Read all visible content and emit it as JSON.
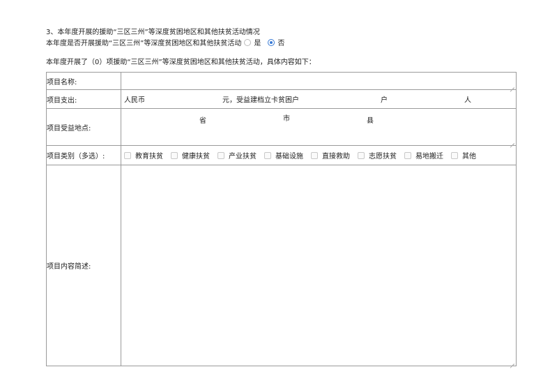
{
  "section": {
    "heading": "3、本年度开展的援助“三区三州”等深度贫困地区和其他扶贫活动情况",
    "question": "本年度是否开展援助“三区三州”等深度贫困地区和其他扶贫活动",
    "options": [
      {
        "label": "是",
        "selected": false
      },
      {
        "label": "否",
        "selected": true
      }
    ],
    "summary": "本年度开展了（0）项援助“三区三州”等深度贫困地区和其他扶贫活动，具体内容如下："
  },
  "form": {
    "name_label": "项目名称:",
    "expense_label": "项目支出:",
    "expense_prefix": "人民币",
    "expense_unit": "元，受益建档立卡贫困户",
    "household_unit": "户",
    "person_unit": "人",
    "location_label": "项目受益地点:",
    "province_unit": "省",
    "city_unit": "市",
    "county_unit": "县",
    "category_label": "项目类别（多选）:",
    "categories": [
      "教育扶贫",
      "健康扶贫",
      "产业扶贫",
      "基础设施",
      "直接救助",
      "志愿扶贫",
      "易地搬迁",
      "其他"
    ],
    "description_label": "项目内容简述:"
  }
}
